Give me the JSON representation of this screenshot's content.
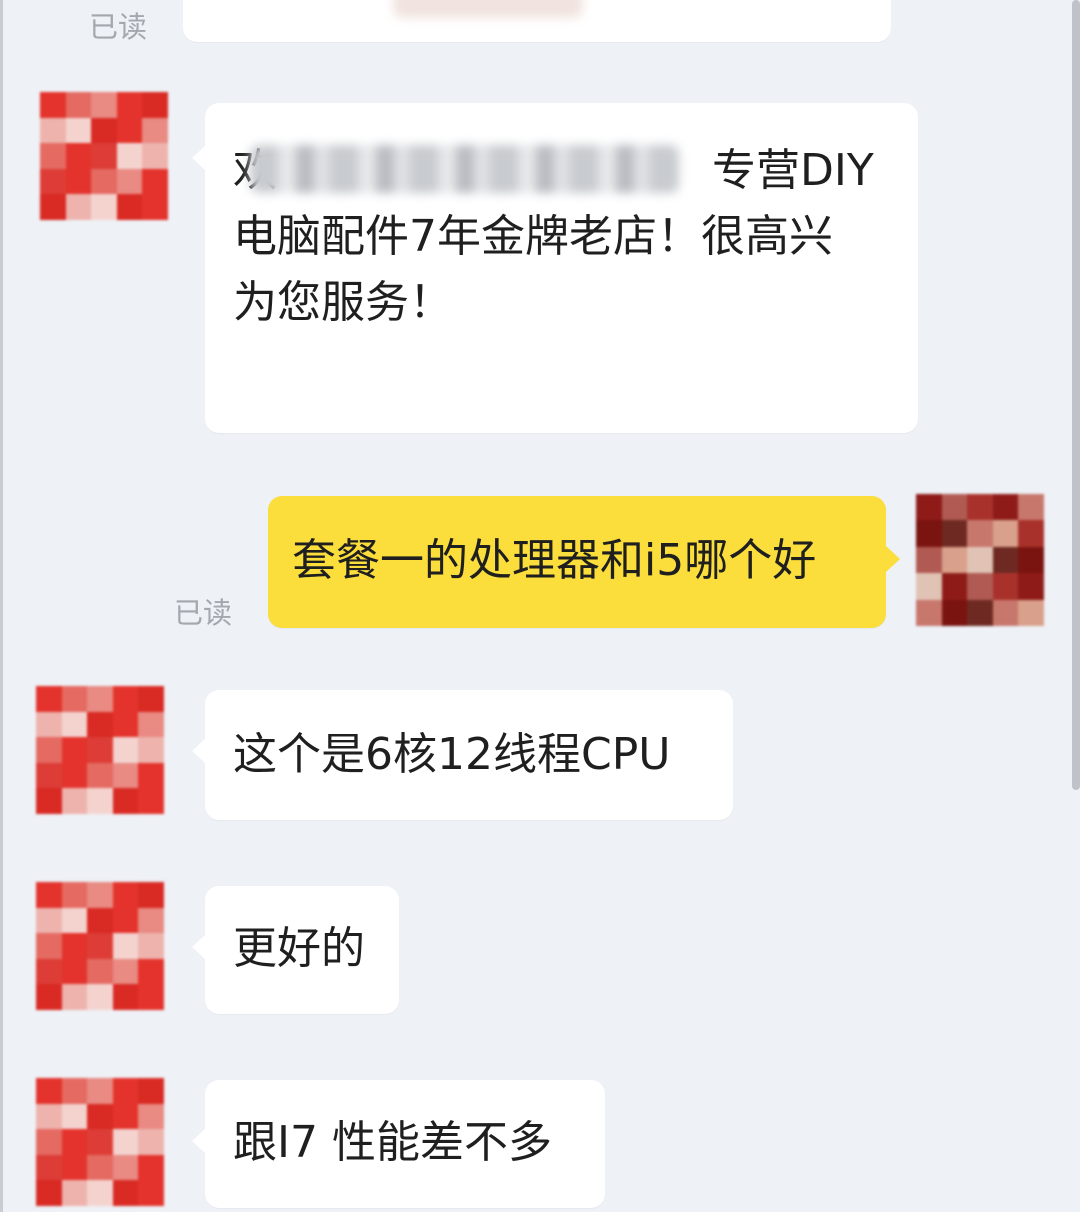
{
  "chat": {
    "messages": [
      {
        "direction": "incoming",
        "lines": [
          "欢",
          "专营DIY",
          "电脑配件7年金牌老店！很高兴",
          "为您服务！"
        ]
      },
      {
        "direction": "outgoing",
        "text": "套餐一的处理器和i5哪个好",
        "status": "已读"
      },
      {
        "direction": "incoming",
        "text": "这个是6核12线程CPU"
      },
      {
        "direction": "incoming",
        "text": "更好的"
      },
      {
        "direction": "incoming",
        "text": "跟I7 性能差不多"
      }
    ],
    "top_status": "已读"
  },
  "colors": {
    "background": "#eef1f6",
    "incoming_bubble": "#ffffff",
    "outgoing_bubble": "#fbde3b",
    "text": "#1f1f1f",
    "status_text": "#a4a8ae",
    "avatar_red": "#e3332c"
  },
  "icons": {
    "shop_avatar": "pixelated-avatar",
    "user_avatar": "pixelated-avatar"
  }
}
